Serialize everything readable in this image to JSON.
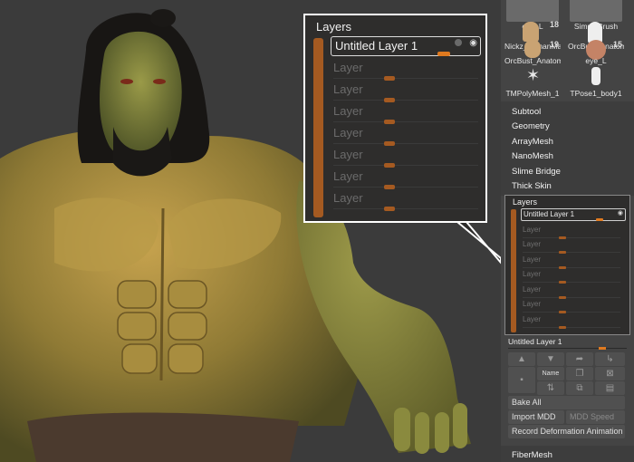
{
  "popout": {
    "title": "Layers",
    "active_layer": "Untitled Layer 1",
    "layers": [
      "Layer",
      "Layer",
      "Layer",
      "Layer",
      "Layer",
      "Layer",
      "Layer"
    ]
  },
  "tool_thumbs": [
    {
      "label": "eye_L",
      "num": ""
    },
    {
      "label": "SimpleBrush",
      "num": "18"
    },
    {
      "label": "Nickz_humanMa",
      "num": "18"
    },
    {
      "label": "OrcBust_Anatom",
      "num": ""
    },
    {
      "label": "OrcBust_Anatom",
      "num": "19"
    },
    {
      "label": "eye_L",
      "num": "15"
    },
    {
      "label": "TMPolyMesh_1",
      "num": ""
    },
    {
      "label": "TPose1_body1",
      "num": ""
    }
  ],
  "menu": [
    "Subtool",
    "Geometry",
    "ArrayMesh",
    "NanoMesh",
    "Slime Bridge",
    "Thick Skin"
  ],
  "layers_panel": {
    "title": "Layers",
    "active_layer": "Untitled Layer 1",
    "layers": [
      "Layer",
      "Layer",
      "Layer",
      "Layer",
      "Layer",
      "Layer",
      "Layer"
    ]
  },
  "layer_controls": {
    "current_layer": "Untitled Layer 1",
    "name_button": "Name",
    "bake_all": "Bake All",
    "import_mdd": "Import MDD",
    "mdd_speed": "MDD Speed",
    "record_deformation": "Record Deformation Animation"
  },
  "fibermesh": "FiberMesh",
  "colors": {
    "accent": "#e07a1f",
    "layer_bar": "#a55a21"
  }
}
